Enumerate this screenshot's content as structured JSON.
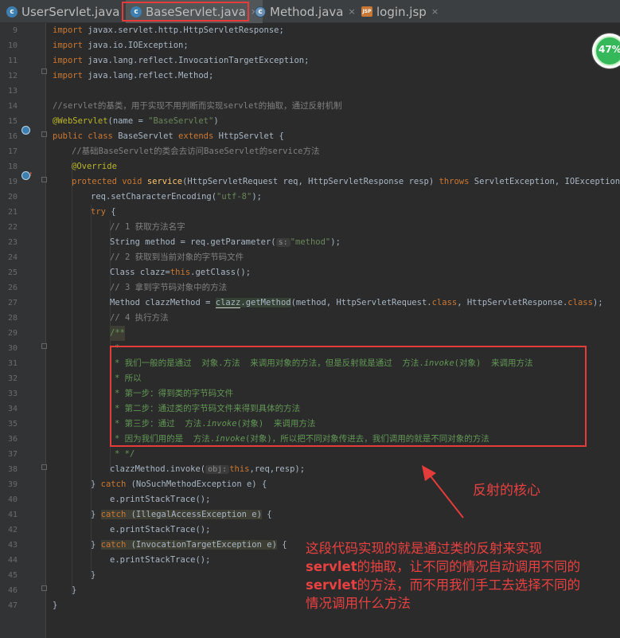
{
  "tabs": [
    {
      "label": "UserServlet.java",
      "icon": "class-c-icon"
    },
    {
      "label": "BaseServlet.java",
      "icon": "class-c-icon",
      "active": true
    },
    {
      "label": "Method.java",
      "icon": "method-class-icon"
    },
    {
      "label": "login.jsp",
      "icon": "jsp-file-icon"
    }
  ],
  "close_glyph": "×",
  "line_numbers": [
    "9",
    "10",
    "11",
    "12",
    "13",
    "14",
    "15",
    "16",
    "17",
    "18",
    "19",
    "20",
    "21",
    "22",
    "23",
    "24",
    "25",
    "26",
    "27",
    "28",
    "29",
    "30",
    "31",
    "32",
    "33",
    "34",
    "35",
    "36",
    "37",
    "38",
    "39",
    "40",
    "41",
    "42",
    "43",
    "44",
    "45",
    "46",
    "47"
  ],
  "code": {
    "l9_a": "import ",
    "l9_b": "javax.servlet.http.HttpServletResponse;",
    "l10_a": "import ",
    "l10_b": "java.io.IOException;",
    "l11_a": "import ",
    "l11_b": "java.lang.reflect.InvocationTargetException;",
    "l12_a": "import ",
    "l12_b": "java.lang.reflect.Method;",
    "l14": "//servlet的基类，用于实现不用判断而实现servlet的抽取，通过反射机制",
    "l15_a": "@WebServlet",
    "l15_b": "(name = ",
    "l15_c": "\"BaseServlet\"",
    "l15_d": ")",
    "l16_a": "public class ",
    "l16_b": "BaseServlet ",
    "l16_c": "extends ",
    "l16_d": "HttpServlet {",
    "l17": "//基础BaseServlet的类会去访问BaseServlet的service方法",
    "l18": "@Override",
    "l19_a": "protected void ",
    "l19_b": "service",
    "l19_c": "(HttpServletRequest req, HttpServletResponse resp) ",
    "l19_d": "throws ",
    "l19_e": "ServletException, IOException {",
    "l20_a": "req.setCharacterEncoding(",
    "l20_b": "\"utf-8\"",
    "l20_c": ");",
    "l21_a": "try ",
    "l21_b": "{",
    "l22": "// 1 获取方法名字",
    "l23_a": "String method = req.getParameter(",
    "l23_hint": "s:",
    "l23_b": "\"method\"",
    "l23_c": ");",
    "l24": "// 2 获取到当前对象的字节码文件",
    "l25_a": "Class clazz=",
    "l25_b": "this",
    "l25_c": ".getClass();",
    "l26": "// 3 拿到字节码对象中的方法",
    "l27_a": "Method clazzMethod = ",
    "l27_b": "clazz",
    "l27_c": ".getMethod",
    "l27_d": "(method, HttpServletRequest.",
    "l27_e": "class",
    "l27_f": ", HttpServletResponse.",
    "l27_g": "class",
    "l27_h": ");",
    "l28": "// 4 执行方法",
    "l29": "/**",
    "l30": "*",
    "l31_a": "* 我们一般的是通过  对象.方法  来调用对象的方法，但是反射就是通过  方法.",
    "l31_b": "invoke",
    "l31_c": "(对象)  来调用方法",
    "l32": "* 所以",
    "l33": "* 第一步：得到类的字节码文件",
    "l34": "* 第二步：通过类的字节码文件来得到具体的方法",
    "l35_a": "* 第三步：通过  方法.",
    "l35_b": "invoke",
    "l35_c": "(对象)  来调用方法",
    "l36_a": "* 因为我们用的是  方法.",
    "l36_b": "invoke",
    "l36_c": "(对象)，所以把不同对象传进去，我们调用的就是不同对象的方法",
    "l37": "* */",
    "l38_a": "clazzMethod.invoke(",
    "l38_hint": "obj:",
    "l38_b": "this",
    "l38_c": ",req,resp);",
    "l39_a": "} ",
    "l39_b": "catch ",
    "l39_c": "(NoSuchMethodException e) {",
    "l40": "e.printStackTrace();",
    "l41_a": "} ",
    "l41_b": "catch",
    "l41_c": " (IllegalAccessException e)",
    "l41_d": " {",
    "l42": "e.printStackTrace();",
    "l43_a": "} ",
    "l43_b": "catch",
    "l43_c": " (InvocationTargetException e)",
    "l43_d": " {",
    "l44": "e.printStackTrace();",
    "l45": "}",
    "l46": "}",
    "l47": "}"
  },
  "annotations": {
    "arrow_label": "反射的核心",
    "note_1": "这段代码实现的就是通过类的反射来实现",
    "note_2a": "servlet",
    "note_2b": "的抽取，让不同的情况自动调用不同的",
    "note_3a": "servlet",
    "note_3b": "的方法，而不用我们手工去选择不同的",
    "note_4": "情况调用什么方法"
  },
  "progress": {
    "label": "47%",
    "value": 47
  },
  "colors": {
    "keyword": "#cc7832",
    "string": "#6a8759",
    "doc_comment": "#629755",
    "annotation": "#bbb529",
    "highlight_box": "#e43b3b"
  }
}
